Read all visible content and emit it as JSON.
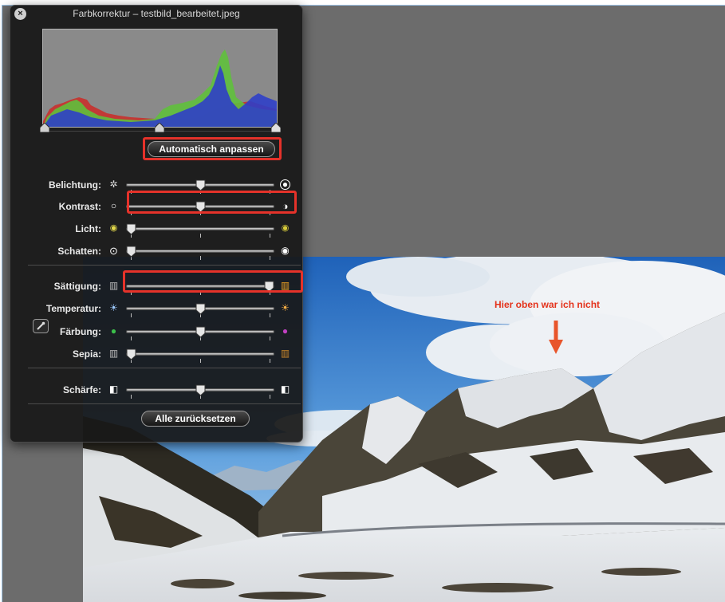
{
  "panel": {
    "title": "Farbkorrektur – testbild_bearbeitet.jpeg",
    "close_icon": "close-icon",
    "auto_button": "Automatisch anpassen",
    "reset_button": "Alle zurücksetzen"
  },
  "sliders": [
    {
      "label": "Belichtung:",
      "icon_left": "aperture-icon",
      "icon_right": "bright-aperture-icon",
      "value": 0.5
    },
    {
      "label": "Kontrast:",
      "icon_left": "contrast-low-icon",
      "icon_right": "contrast-high-icon",
      "value": 0.5
    },
    {
      "label": "Licht:",
      "icon_left": "highlight-low-icon",
      "icon_right": "highlight-high-icon",
      "value": 0.0
    },
    {
      "label": "Schatten:",
      "icon_left": "shadow-low-icon",
      "icon_right": "shadow-high-icon",
      "value": 0.0
    },
    {
      "label": "Sättigung:",
      "icon_left": "desaturated-icon",
      "icon_right": "saturated-icon",
      "value": 1.0
    },
    {
      "label": "Temperatur:",
      "icon_left": "cool-sun-icon",
      "icon_right": "warm-sun-icon",
      "value": 0.5
    },
    {
      "label": "Färbung:",
      "icon_left": "green-tint-icon",
      "icon_right": "magenta-tint-icon",
      "value": 0.5
    },
    {
      "label": "Sepia:",
      "icon_left": "no-sepia-icon",
      "icon_right": "sepia-icon",
      "value": 0.0
    },
    {
      "label": "Schärfe:",
      "icon_left": "soft-icon",
      "icon_right": "sharp-icon",
      "value": 0.5
    }
  ],
  "eyedropper_icon": "eyedropper-icon",
  "photo": {
    "annotation": "Hier oben war ich nicht",
    "arrow_icon": "arrow-down-icon"
  },
  "colors": {
    "highlight_box": "#e5322a",
    "annotation": "#e4331c",
    "hist_red": "#c8302c",
    "hist_green": "#5fc03c",
    "hist_blue": "#2f3fc8"
  }
}
